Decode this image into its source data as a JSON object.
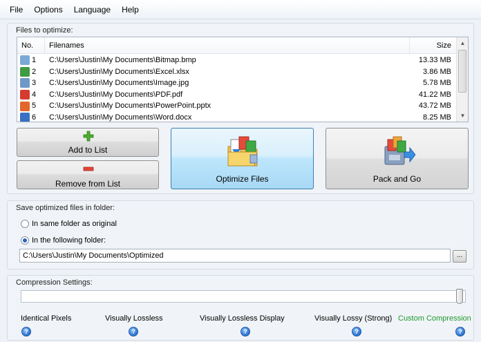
{
  "menu": {
    "file": "File",
    "options": "Options",
    "language": "Language",
    "help": "Help"
  },
  "files_group": {
    "title": "Files to optimize:",
    "columns": {
      "no": "No.",
      "filename": "Filenames",
      "size": "Size"
    },
    "rows": [
      {
        "no": "1",
        "icon": "bmp-file-icon",
        "filename": "C:\\Users\\Justin\\My Documents\\Bitmap.bmp",
        "size": "13.33 MB"
      },
      {
        "no": "2",
        "icon": "excel-file-icon",
        "filename": "C:\\Users\\Justin\\My Documents\\Excel.xlsx",
        "size": "3.86 MB"
      },
      {
        "no": "3",
        "icon": "image-file-icon",
        "filename": "C:\\Users\\Justin\\My Documents\\Image.jpg",
        "size": "5.78 MB"
      },
      {
        "no": "4",
        "icon": "pdf-file-icon",
        "filename": "C:\\Users\\Justin\\My Documents\\PDF.pdf",
        "size": "41.22 MB"
      },
      {
        "no": "5",
        "icon": "powerpoint-file-icon",
        "filename": "C:\\Users\\Justin\\My Documents\\PowerPoint.pptx",
        "size": "43.72 MB"
      },
      {
        "no": "6",
        "icon": "word-file-icon",
        "filename": "C:\\Users\\Justin\\My Documents\\Word.docx",
        "size": "8.25 MB"
      }
    ]
  },
  "buttons": {
    "add": "Add to List",
    "remove": "Remove from List",
    "optimize": "Optimize Files",
    "pack": "Pack and Go"
  },
  "save_group": {
    "title": "Save optimized files in folder:",
    "option_same": "In same folder as original",
    "option_following": "In the following folder:",
    "selected": "following",
    "folder_path": "C:\\Users\\Justin\\My Documents\\Optimized",
    "browse_label": "..."
  },
  "compression_group": {
    "title": "Compression Settings:",
    "levels": [
      "Identical Pixels",
      "Visually Lossless",
      "Visually Lossless Display",
      "Visually Lossy (Strong)",
      "Custom Compression"
    ],
    "selected_level": "Custom Compression",
    "help_glyph": "?"
  },
  "colors": {
    "custom_level": "#1f9a2e",
    "selected_button": "#bee6fd"
  }
}
